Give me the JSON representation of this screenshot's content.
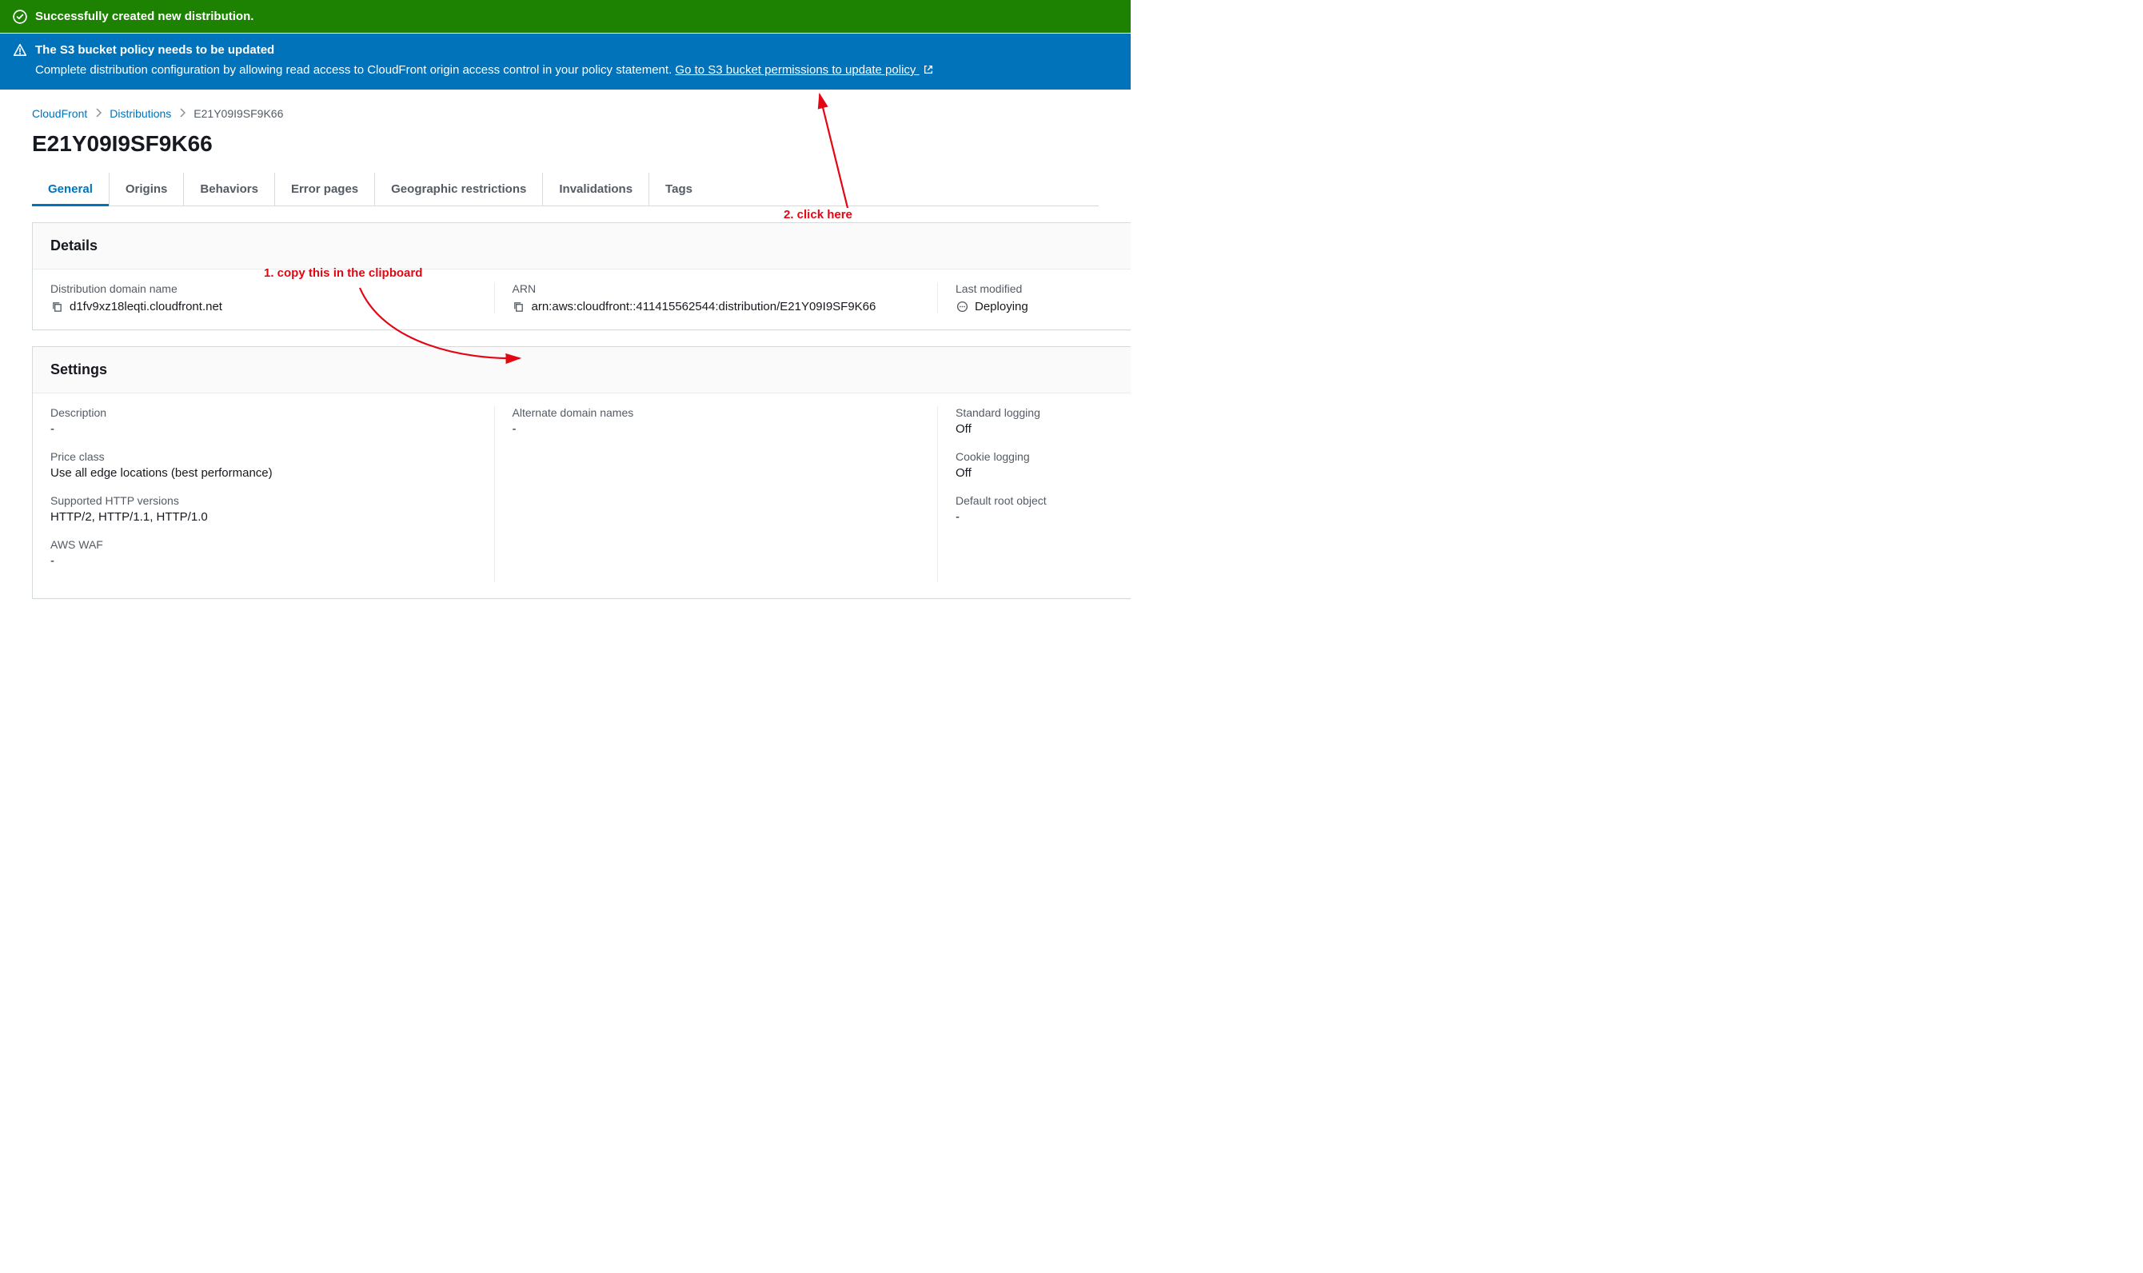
{
  "banners": {
    "success": "Successfully created new distribution.",
    "info_title": "The S3 bucket policy needs to be updated",
    "info_desc": "Complete distribution configuration by allowing read access to CloudFront origin access control in your policy statement. ",
    "info_link": "Go to S3 bucket permissions to update policy "
  },
  "breadcrumbs": {
    "root": "CloudFront",
    "second": "Distributions",
    "current": "E21Y09I9SF9K66"
  },
  "title": "E21Y09I9SF9K66",
  "tabs": {
    "general": "General",
    "origins": "Origins",
    "behaviors": "Behaviors",
    "error_pages": "Error pages",
    "geo": "Geographic restrictions",
    "invalidations": "Invalidations",
    "tags": "Tags"
  },
  "details": {
    "header": "Details",
    "domain_label": "Distribution domain name",
    "domain_value": "d1fv9xz18leqti.cloudfront.net",
    "arn_label": "ARN",
    "arn_value": "arn:aws:cloudfront::411415562544:distribution/E21Y09I9SF9K66",
    "modified_label": "Last modified",
    "modified_value": "Deploying"
  },
  "settings": {
    "header": "Settings",
    "col1": {
      "description_k": "Description",
      "description_v": "-",
      "price_k": "Price class",
      "price_v": "Use all edge locations (best performance)",
      "http_k": "Supported HTTP versions",
      "http_v": "HTTP/2, HTTP/1.1, HTTP/1.0",
      "waf_k": "AWS WAF",
      "waf_v": "-"
    },
    "col2": {
      "alt_k": "Alternate domain names",
      "alt_v": "-"
    },
    "col3": {
      "stdlog_k": "Standard logging",
      "stdlog_v": "Off",
      "cookielog_k": "Cookie logging",
      "cookielog_v": "Off",
      "root_k": "Default root object",
      "root_v": "-"
    }
  },
  "annotations": {
    "a1": "1. copy this in the clipboard",
    "a2": "2. click here"
  }
}
